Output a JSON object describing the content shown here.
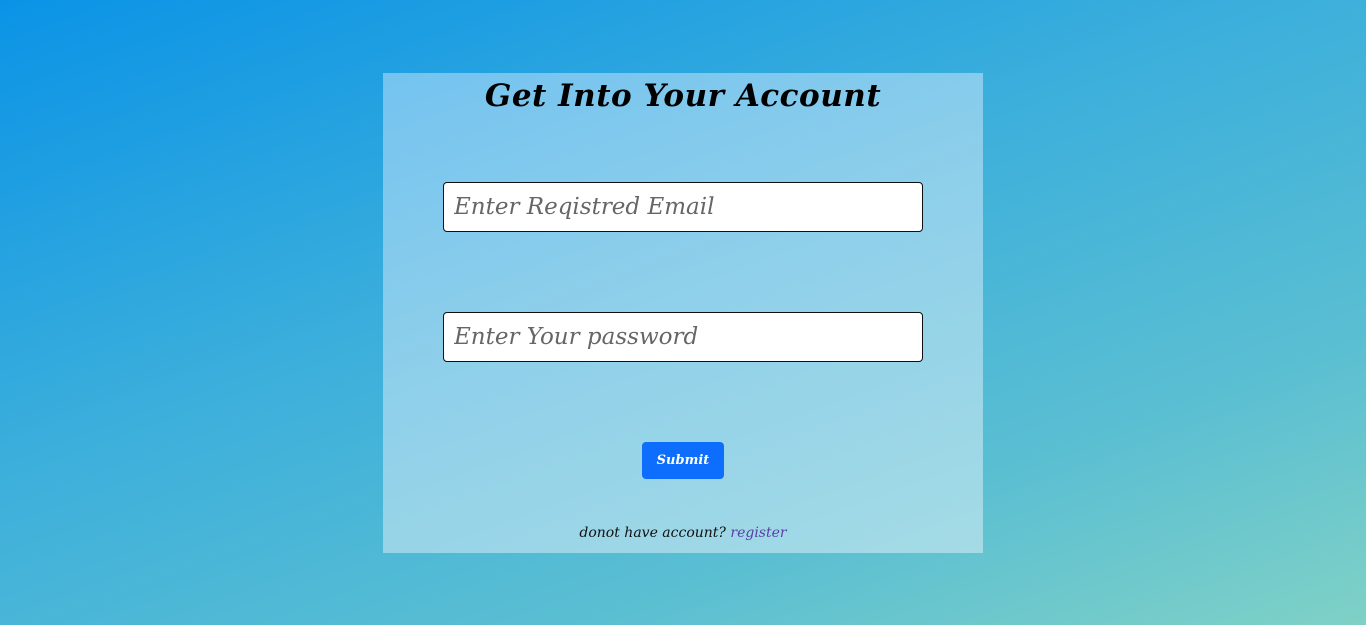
{
  "page": {
    "background_colors": [
      "#0a93e6",
      "#7fd1c6"
    ]
  },
  "login_card": {
    "title": "Get Into Your Account",
    "email_field": {
      "placeholder": "Enter Reqistred Email",
      "value": ""
    },
    "password_field": {
      "placeholder": "Enter Your password",
      "value": ""
    },
    "submit_label": "Submit",
    "footer": {
      "prompt_text": "donot have account?",
      "link_text": "register"
    },
    "colors": {
      "button": "#0d6efd",
      "link": "#5a3ea8"
    }
  }
}
